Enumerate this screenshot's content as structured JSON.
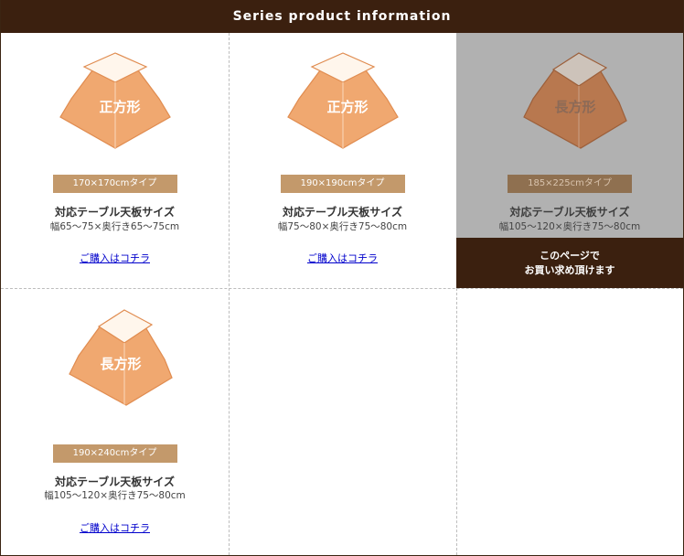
{
  "header": {
    "title": "Series product information"
  },
  "colors": {
    "header_bg": "#3b200f",
    "badge": "#c3996b",
    "shape_top": "#fff6ec",
    "shape_front": "#f0a870",
    "current_bg": "#b1b1b1",
    "link": "#0000cc"
  },
  "products": [
    {
      "shape_label": "正方形",
      "size": "170×170cmタイプ",
      "spec_title": "対応テーブル天板サイズ",
      "spec_dims": "幅65～75×奥行き65～75cm",
      "link_text": "ご購入はコチラ"
    },
    {
      "shape_label": "正方形",
      "size": "190×190cmタイプ",
      "spec_title": "対応テーブル天板サイズ",
      "spec_dims": "幅75～80×奥行き75～80cm",
      "link_text": "ご購入はコチラ"
    },
    {
      "shape_label": "長方形",
      "size": "185×225cmタイプ",
      "spec_title": "対応テーブル天板サイズ",
      "spec_dims": "幅105～120×奥行き75～80cm",
      "current_line1": "このページで",
      "current_line2": "お買い求め頂けます"
    },
    {
      "shape_label": "長方形",
      "size": "190×240cmタイプ",
      "spec_title": "対応テーブル天板サイズ",
      "spec_dims": "幅105～120×奥行き75～80cm",
      "link_text": "ご購入はコチラ"
    }
  ]
}
